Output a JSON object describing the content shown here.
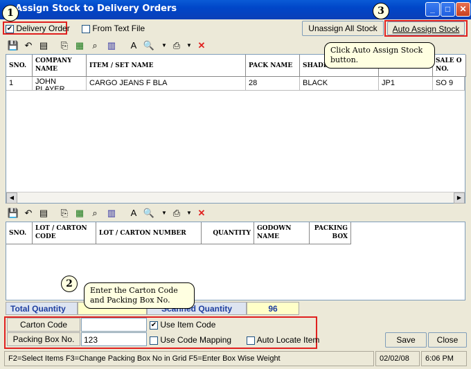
{
  "window": {
    "title": "Assign Stock to Delivery Orders"
  },
  "options": {
    "delivery_order": "Delivery Order",
    "from_text_file": "From Text File"
  },
  "buttons": {
    "unassign_all": "Unassign All Stock",
    "auto_assign": "Auto Assign Stock",
    "save": "Save",
    "close": "Close"
  },
  "callouts": {
    "one": "1",
    "two": "2",
    "three": "3",
    "auto_assign_tip": "Click  Auto Assign Stock button.",
    "carton_tip": "Enter the Carton Code and Packing Box No."
  },
  "top_grid": {
    "headers": [
      "SNO.",
      "COMPANY NAME",
      "ITEM / SET NAME",
      "PACK NAME",
      "SHADE",
      "",
      "SALE O NO."
    ],
    "rows": [
      [
        "1",
        "JOHN PLAYER",
        "CARGO JEANS F BLA",
        "28",
        "BLACK",
        "JP1",
        "SO  9"
      ]
    ]
  },
  "bottom_grid": {
    "headers": [
      "SNO.",
      "LOT / CARTON CODE",
      "LOT / CARTON NUMBER",
      "QUANTITY",
      "GODOWN NAME",
      "PACKING BOX"
    ]
  },
  "totals": {
    "total_label": "Total Quantity",
    "scanned_label": "Scanned Quantity",
    "scanned_value": "96"
  },
  "form": {
    "carton_label": "Carton Code",
    "carton_value": "",
    "packing_label": "Packing Box No.",
    "packing_value": "123",
    "use_item_code": "Use Item Code",
    "use_code_mapping": "Use Code Mapping",
    "auto_locate": "Auto Locate Item"
  },
  "status": {
    "hints": "F2=Select Items  F3=Change Packing Box No in Grid  F5=Enter Box Wise Weight",
    "date": "02/02/08",
    "time": "6:06 PM"
  }
}
